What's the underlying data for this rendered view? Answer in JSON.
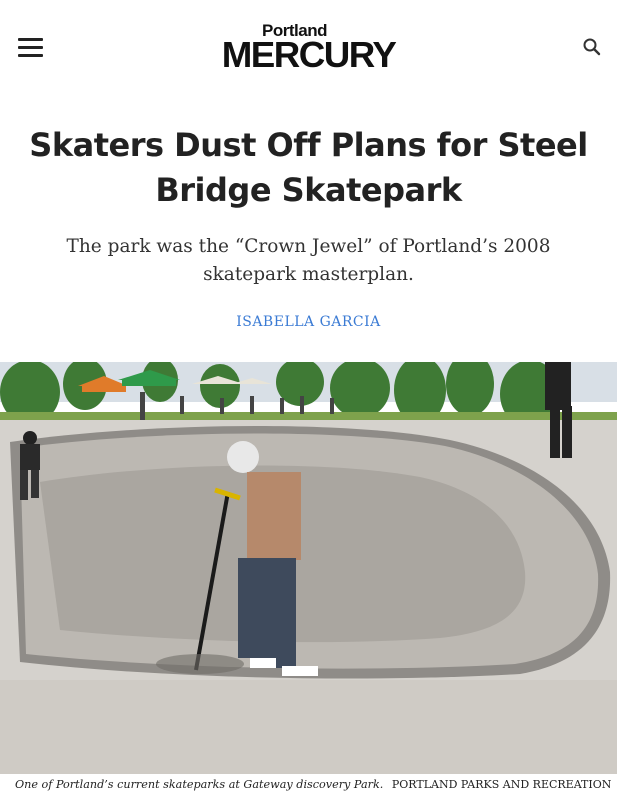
{
  "header": {
    "logo_top": "Portland",
    "logo_main": "MERCURY",
    "menu_icon": "hamburger-menu-icon",
    "search_icon": "search-icon"
  },
  "article": {
    "headline": "Skaters Dust Off Plans for Steel Bridge Skatepark",
    "dek": "The park was the “Crown Jewel” of Portland’s 2008 skatepark masterplan.",
    "author": "ISABELLA GARCIA"
  },
  "photo": {
    "caption": "One of Portland’s current skateparks at Gateway discovery Park.",
    "credit": "PORTLAND PARKS AND RECREATION"
  },
  "colors": {
    "byline": "#3b7bd4",
    "text": "#222222",
    "concrete": "#c9c6c1",
    "foliage": "#3f7a35"
  }
}
